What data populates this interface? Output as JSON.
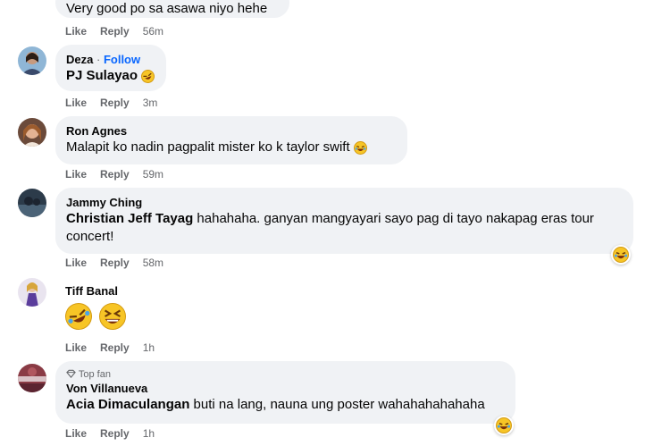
{
  "comments": [
    {
      "text": "Very good po sa asawa niyo hehe",
      "like": "Like",
      "reply": "Reply",
      "time": "56m"
    },
    {
      "author": "Deza",
      "separator": "·",
      "follow": "Follow",
      "mention": "PJ Sulayao",
      "text": "",
      "like": "Like",
      "reply": "Reply",
      "time": "3m"
    },
    {
      "author": "Ron Agnes",
      "text": "Malapit ko nadin pagpalit mister ko k taylor swift",
      "like": "Like",
      "reply": "Reply",
      "time": "59m"
    },
    {
      "author": "Jammy Ching",
      "mention": "Christian Jeff Tayag",
      "text": " hahahaha. ganyan mangyayari sayo pag di tayo nakapag eras tour concert!",
      "like": "Like",
      "reply": "Reply",
      "time": "58m"
    },
    {
      "author": "Tiff Banal",
      "like": "Like",
      "reply": "Reply",
      "time": "1h"
    },
    {
      "badge": "Top fan",
      "author": "Von Villanueva",
      "mention": "Acia Dimaculangan",
      "text": " buti na lang, nauna ung poster wahahahahahaha",
      "like": "Like",
      "reply": "Reply",
      "time": "1h"
    }
  ],
  "icons": {
    "laugh": "laughing-emoji-icon",
    "rofl": "rofl-emoji-icon",
    "grin": "grinning-squint-emoji-icon",
    "diamond": "top-fan-diamond-icon"
  },
  "colors": {
    "bubble": "#f0f2f5",
    "meta": "#65676b",
    "follow": "#0866ff"
  }
}
